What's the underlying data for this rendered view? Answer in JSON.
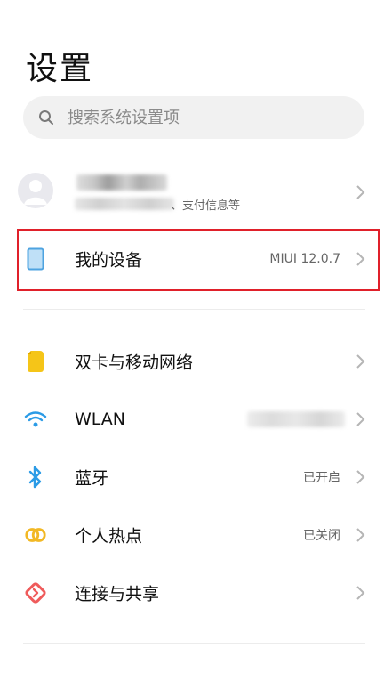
{
  "page": {
    "title": "设置"
  },
  "search": {
    "placeholder": "搜索系统设置项"
  },
  "account": {
    "subtitle_suffix": "、支付信息等"
  },
  "device": {
    "label": "我的设备",
    "value": "MIUI 12.0.7"
  },
  "network": [
    {
      "label": "双卡与移动网络",
      "value": "",
      "icon": "sim-card-icon",
      "color": "#f5c518"
    },
    {
      "label": "WLAN",
      "value": "",
      "icon": "wifi-icon",
      "color": "#2b9be6"
    },
    {
      "label": "蓝牙",
      "value": "已开启",
      "icon": "bluetooth-icon",
      "color": "#2b9be6"
    },
    {
      "label": "个人热点",
      "value": "已关闭",
      "icon": "hotspot-icon",
      "color": "#f2b824"
    },
    {
      "label": "连接与共享",
      "value": "",
      "icon": "connection-share-icon",
      "color": "#ef5b5b"
    }
  ],
  "colors": {
    "highlight": "#e0202a",
    "device_icon": "#4ea3e0"
  }
}
